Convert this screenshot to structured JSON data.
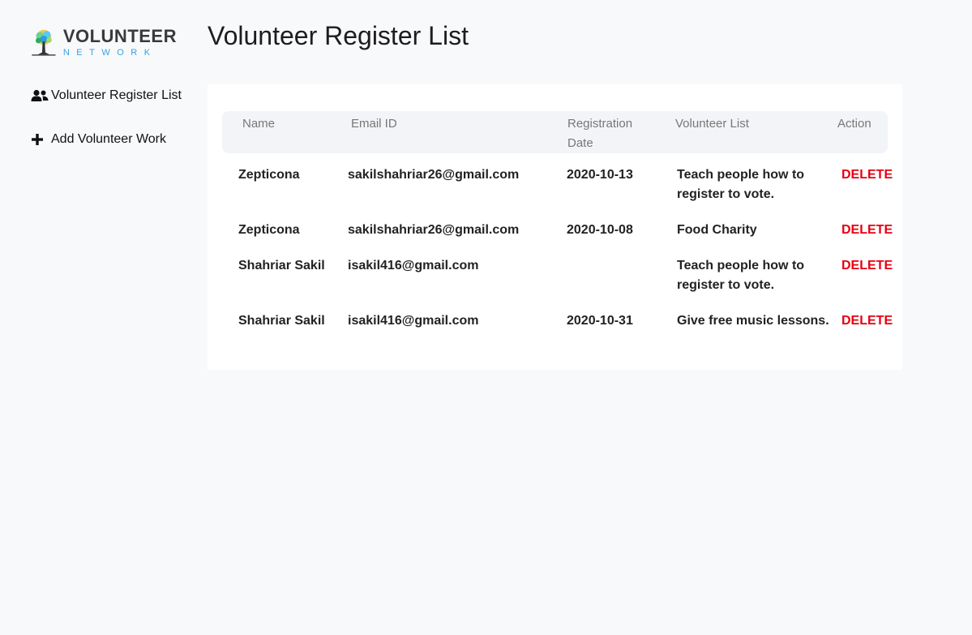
{
  "logo": {
    "main": "VOLUNTEER",
    "sub": "NETWORK"
  },
  "sidebar": {
    "items": [
      {
        "label": "Volunteer Register List",
        "icon": "users-icon"
      },
      {
        "label": "Add Volunteer Work",
        "icon": "plus-icon"
      }
    ]
  },
  "page_title": "Volunteer Register List",
  "table": {
    "headers": {
      "name": "Name",
      "email": "Email ID",
      "date_line1": "Registration",
      "date_line2": "Date",
      "volunteer": "Volunteer List",
      "action": "Action"
    },
    "rows": [
      {
        "name": "Zepticona",
        "email": "sakilshahriar26@gmail.com",
        "date": "2020-10-13",
        "work_line1": "Teach people how to",
        "work_line2": "register to vote.",
        "action": "DELETE"
      },
      {
        "name": "Zepticona",
        "email": "sakilshahriar26@gmail.com",
        "date": "2020-10-08",
        "work_line1": "Food Charity",
        "work_line2": "",
        "action": "DELETE"
      },
      {
        "name": "Shahriar Sakil",
        "email": "isakil416@gmail.com",
        "date": "",
        "work_line1": "Teach people how to",
        "work_line2": "register to vote.",
        "action": "DELETE"
      },
      {
        "name": "Shahriar Sakil",
        "email": "isakil416@gmail.com",
        "date": "2020-10-31",
        "work_line1": "Give free music lessons.",
        "work_line2": "",
        "action": "DELETE"
      }
    ]
  },
  "colors": {
    "delete": "#e60012",
    "logo_sub": "#3aa0e0",
    "background": "#f8f9fb"
  }
}
